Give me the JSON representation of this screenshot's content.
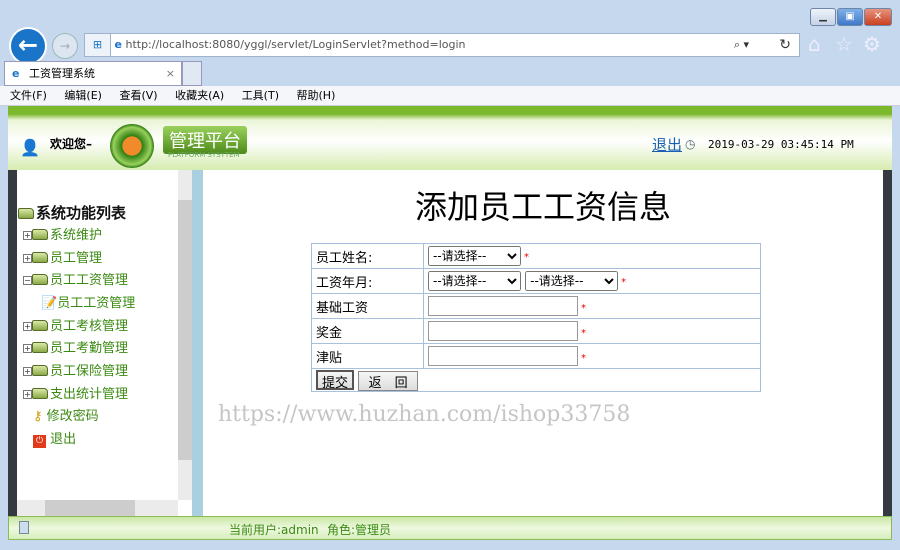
{
  "browser": {
    "url": "http://localhost:8080/yggl/servlet/LoginServlet?method=login",
    "tab_title": "工资管理系统",
    "menu": [
      "文件(F)",
      "编辑(E)",
      "查看(V)",
      "收藏夹(A)",
      "工具(T)",
      "帮助(H)"
    ]
  },
  "header": {
    "welcome": "欢迎您–",
    "logo_title": "管理平台",
    "logo_sub": "PLATFORM SYSYTEM",
    "logout": "退出",
    "datetime": "2019-03-29 03:45:14 PM"
  },
  "sidebar": {
    "title": "系统功能列表",
    "items": [
      {
        "label": "系统维护",
        "state": "+"
      },
      {
        "label": "员工管理",
        "state": "+"
      },
      {
        "label": "员工工资管理",
        "state": "-"
      },
      {
        "label": "员工工资管理",
        "state": "child"
      },
      {
        "label": "员工考核管理",
        "state": "+"
      },
      {
        "label": "员工考勤管理",
        "state": "+"
      },
      {
        "label": "员工保险管理",
        "state": "+"
      },
      {
        "label": "支出统计管理",
        "state": "+"
      },
      {
        "label": "修改密码",
        "state": "leaf"
      },
      {
        "label": "退出",
        "state": "leaf"
      }
    ]
  },
  "form": {
    "title": "添加员工工资信息",
    "name_label": "员工姓名:",
    "month_label": "工资年月:",
    "base_label": "基础工资",
    "bonus_label": "奖金",
    "allowance_label": "津贴",
    "select_placeholder": "--请选择--",
    "required": "*",
    "submit": "提交",
    "back": "返　回"
  },
  "watermark": "https://www.huzhan.com/ishop33758",
  "footer": {
    "user": "当前用户:admin",
    "role": "角色:管理员"
  }
}
